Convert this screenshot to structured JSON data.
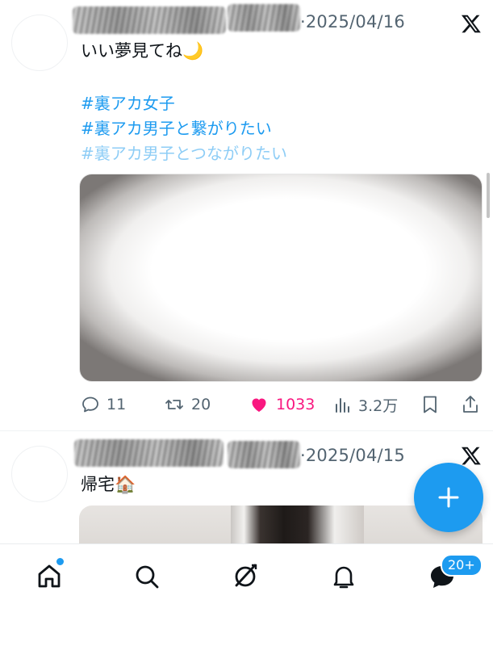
{
  "post1": {
    "date": "·2025/04/16",
    "text": "いい夢見てね🌙",
    "hashtags": [
      "#裏アカ女子",
      "#裏アカ男子と繋がりたい",
      "#裏アカ男子とつながりたい"
    ],
    "stats": {
      "replies": "11",
      "reposts": "20",
      "likes": "1033",
      "views": "3.2万"
    },
    "liked": true
  },
  "post2": {
    "date": "·2025/04/15",
    "text": "帰宅🏠"
  },
  "compose_icon": "plus-icon",
  "nav": {
    "items": [
      "home-icon",
      "search-icon",
      "grok-icon",
      "notifications-icon",
      "messages-icon"
    ],
    "messages_badge": "20+"
  },
  "colors": {
    "accent": "#1d9bf0",
    "like": "#f91880",
    "muted": "#536471"
  }
}
